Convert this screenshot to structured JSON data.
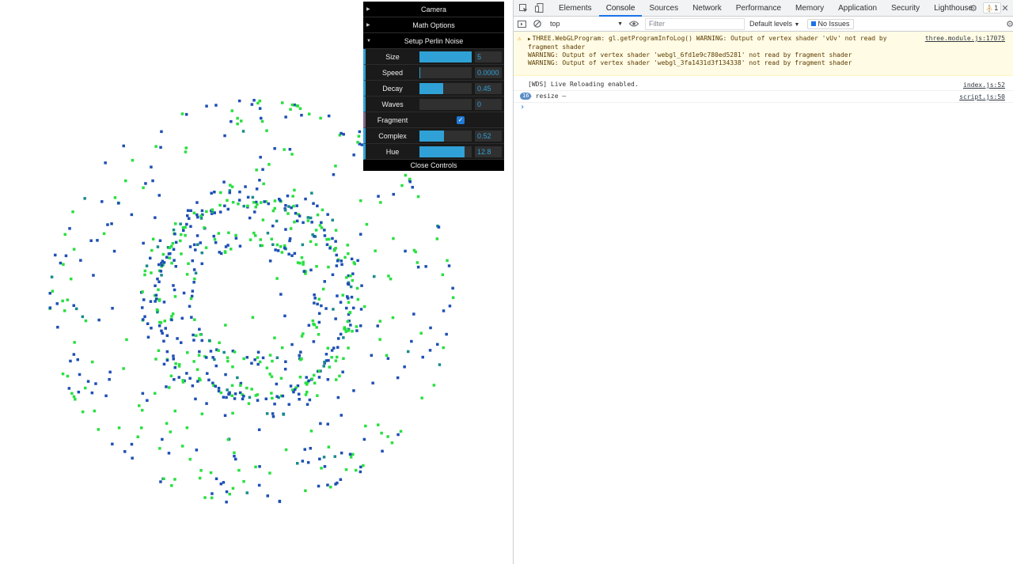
{
  "gui": {
    "folders": {
      "camera": "Camera",
      "math_options": "Math Options",
      "setup_perlin_noise": "Setup Perlin Noise"
    },
    "controls": [
      {
        "label": "Size",
        "value": "5",
        "fraction": 1.0
      },
      {
        "label": "Speed",
        "value": "0.0000",
        "fraction": 0.02
      },
      {
        "label": "Decay",
        "value": "0.45",
        "fraction": 0.45
      },
      {
        "label": "Waves",
        "value": "0",
        "fraction": 0.0
      },
      {
        "label": "Complex",
        "value": "0.52",
        "fraction": 0.47
      },
      {
        "label": "Hue",
        "value": "12.8",
        "fraction": 0.86
      }
    ],
    "fragment_label": "Fragment",
    "fragment_checked": true,
    "close_label": "Close Controls"
  },
  "devtools": {
    "tabs": [
      "Elements",
      "Console",
      "Sources",
      "Network",
      "Performance",
      "Memory",
      "Application",
      "Security",
      "Lighthouse"
    ],
    "active_tab": "Console",
    "warning_count": "1",
    "context": "top",
    "filter_placeholder": "Filter",
    "levels": "Default levels",
    "issues": "No Issues",
    "messages": {
      "warning_line1": "THREE.WebGLProgram: gl.getProgramInfoLog() WARNING: Output of vertex shader 'vUv' not read by",
      "warning_line2": "fragment shader",
      "warning_line3": "WARNING: Output of vertex shader 'webgl_6fd1e9c780ed5281' not read by fragment shader",
      "warning_line4": "WARNING: Output of vertex shader 'webgl_3fa1431d3f134338' not read by fragment shader",
      "warning_src": "three.module.js:17075",
      "wds_text": "[WDS] Live Reloading enabled.",
      "wds_src": "index.js:52",
      "resize_count": "16",
      "resize_text": "– resize –",
      "resize_src": "script.js:50"
    }
  },
  "colors": {
    "gui_accent": "#2fa1d6",
    "point_blue": "#1e50b4",
    "point_green": "#28e040",
    "point_teal": "#1a8a8a"
  }
}
